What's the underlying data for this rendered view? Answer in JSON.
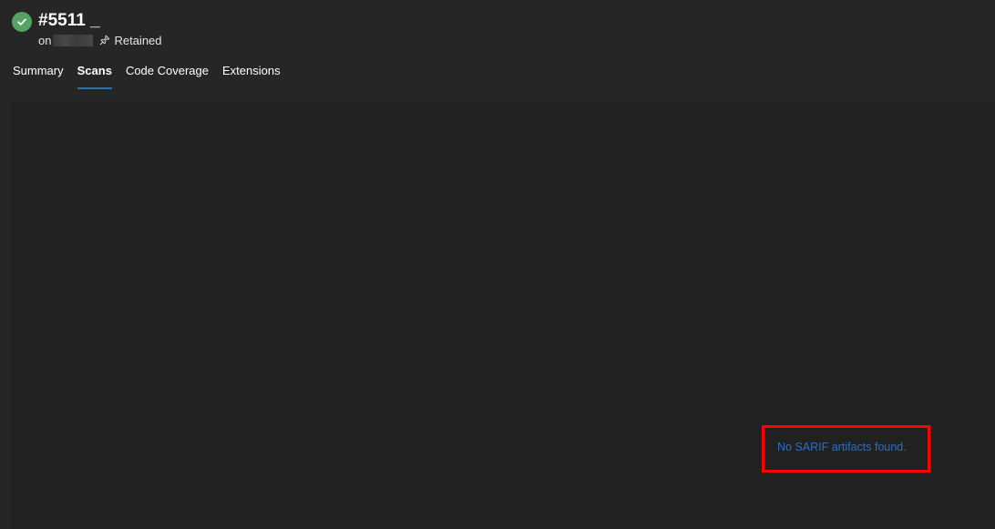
{
  "header": {
    "status": "succeeded",
    "status_color": "#55a362",
    "status_icon": "check-circle-icon",
    "title": "#5511 _",
    "subtitle_prefix": "on",
    "retained_icon": "pin-icon",
    "retained_label": "Retained"
  },
  "tabs": [
    {
      "label": "Summary",
      "active": false
    },
    {
      "label": "Scans",
      "active": true
    },
    {
      "label": "Code Coverage",
      "active": false
    },
    {
      "label": "Extensions",
      "active": false
    }
  ],
  "main": {
    "empty_message": "No SARIF artifacts found.",
    "empty_message_color": "#2e6fbd",
    "highlight_color": "#ff0000"
  },
  "colors": {
    "background": "#262626",
    "panel": "#212121",
    "tab_underline": "#2f6fb0"
  }
}
